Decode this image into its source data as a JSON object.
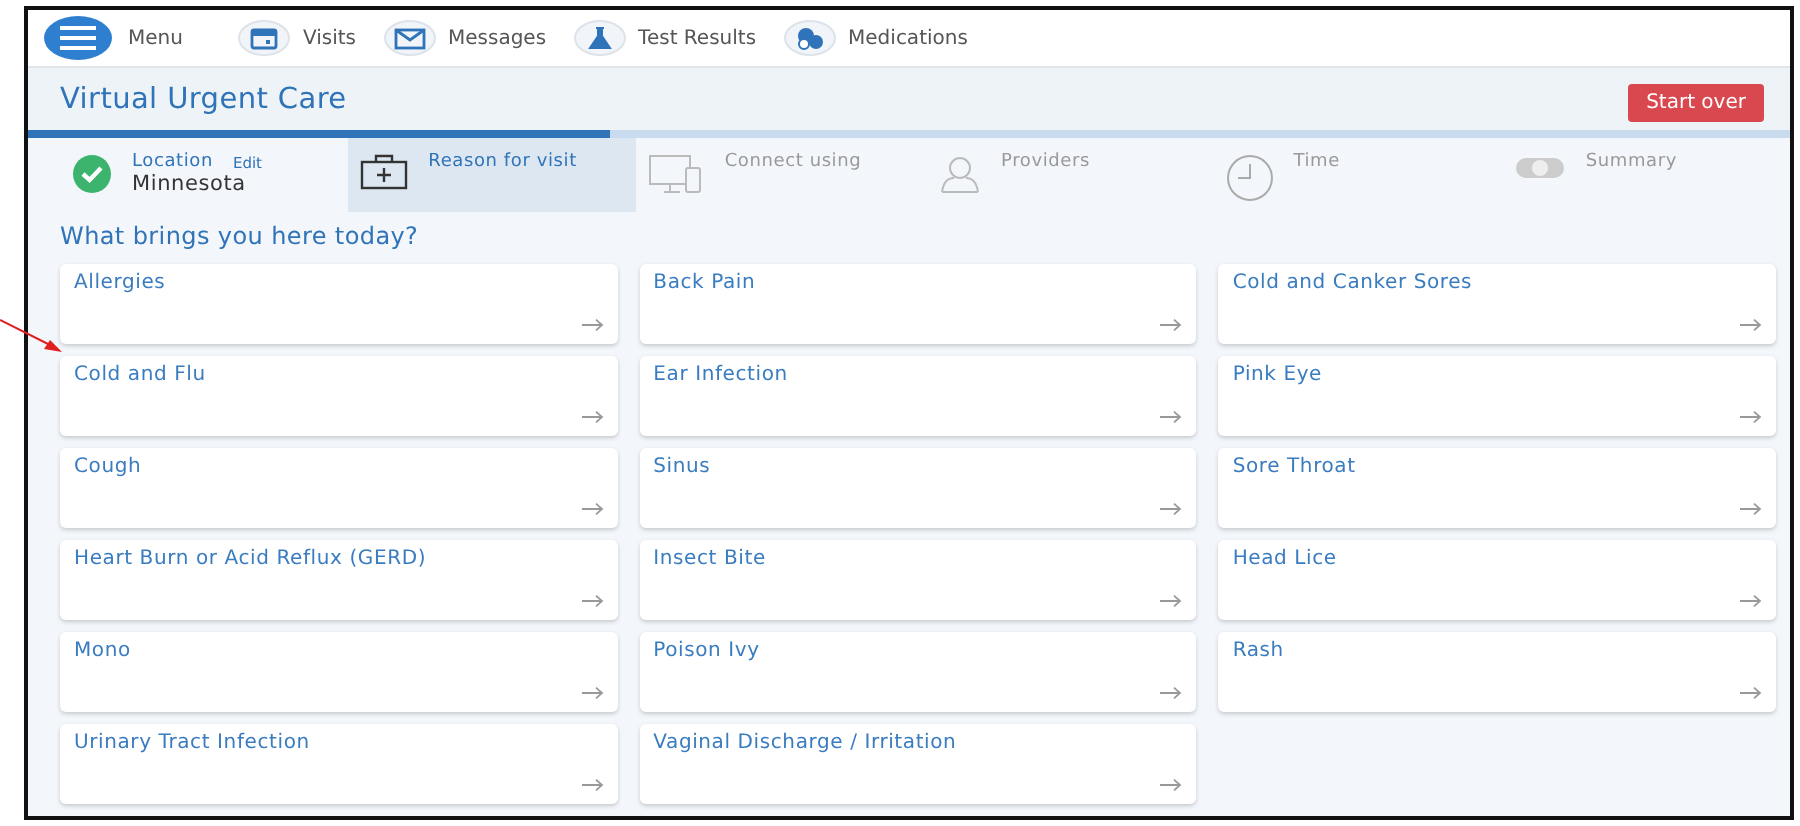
{
  "nav": {
    "menu_label": "Menu",
    "items": [
      {
        "label": "Visits"
      },
      {
        "label": "Messages"
      },
      {
        "label": "Test Results"
      },
      {
        "label": "Medications"
      }
    ]
  },
  "header": {
    "title": "Virtual Urgent Care",
    "button": "Start over"
  },
  "progress": {
    "level": 0.33
  },
  "steps": [
    {
      "label": "Location",
      "completed": true,
      "edit": "Edit",
      "value": "Minnesota",
      "selected": false
    },
    {
      "label": "Reason for visit",
      "completed": false,
      "selected": true
    },
    {
      "label": "Connect using",
      "completed": false,
      "selected": false
    },
    {
      "label": "Providers",
      "completed": false,
      "selected": false
    },
    {
      "label": "Time",
      "completed": false,
      "selected": false
    },
    {
      "label": "Summary",
      "completed": false,
      "selected": false
    }
  ],
  "question": "What brings you here today?",
  "reasons": [
    {
      "label": "Allergies"
    },
    {
      "label": "Back Pain"
    },
    {
      "label": "Cold and Canker Sores"
    },
    {
      "label": "Cold and Flu"
    },
    {
      "label": "Ear Infection"
    },
    {
      "label": "Pink Eye"
    },
    {
      "label": "Cough"
    },
    {
      "label": "Sinus"
    },
    {
      "label": "Sore Throat"
    },
    {
      "label": "Heart Burn or Acid Reflux (GERD)"
    },
    {
      "label": "Insect Bite"
    },
    {
      "label": "Head Lice"
    },
    {
      "label": "Mono"
    },
    {
      "label": "Poison Ivy"
    },
    {
      "label": "Rash"
    },
    {
      "label": "Urinary Tract Infection"
    },
    {
      "label": "Vaginal Discharge / Irritation"
    }
  ]
}
